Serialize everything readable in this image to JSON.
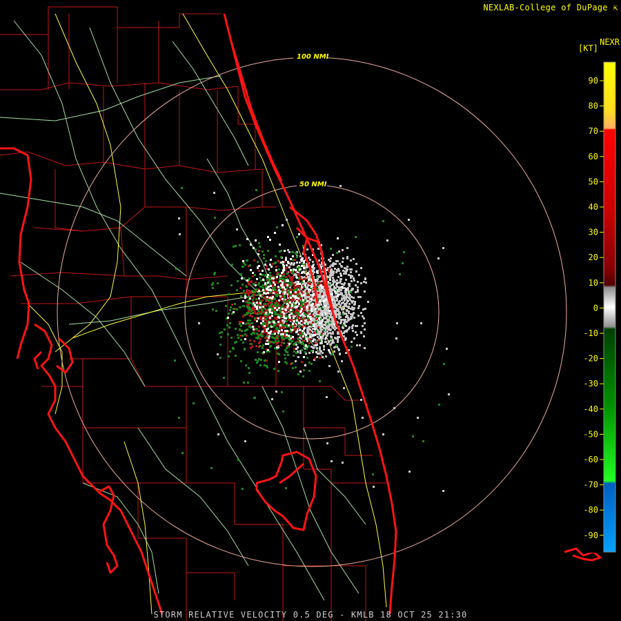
{
  "header": {
    "credit": "NEXLAB-College of DuPage",
    "product": "NEXR",
    "units": "[KT]"
  },
  "footer": {
    "caption": "STORM RELATIVE VELOCITY 0.5 DEG - KMLB 18 OCT 25 21:30"
  },
  "range_rings": [
    {
      "label": "100 NMI"
    },
    {
      "label": "50 NMI"
    }
  ],
  "legend": {
    "ticks": [
      "90",
      "80",
      "70",
      "60",
      "50",
      "40",
      "30",
      "20",
      "10",
      "0",
      "-10",
      "-20",
      "-30",
      "-40",
      "-50",
      "-60",
      "-70",
      "-80",
      "-90"
    ]
  },
  "colors": {
    "coast": "#ff1010",
    "county": "#c81414",
    "road_primary": "#ffff40",
    "road_secondary": "#a0e0a0",
    "ring": "#f0b0a0",
    "inbound_green": "#1a8a1a",
    "outbound_red": "#b01818",
    "near_zero": "#c8c8c8"
  }
}
